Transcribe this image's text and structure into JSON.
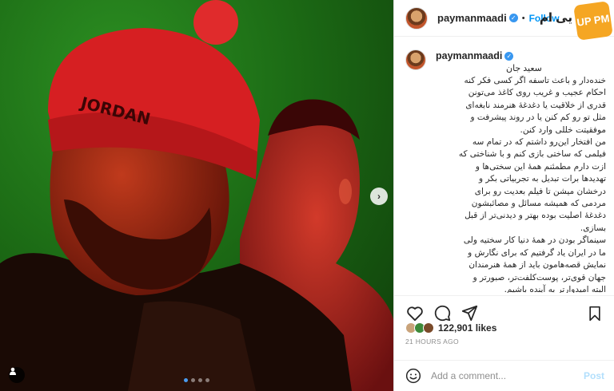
{
  "post": {
    "username": "paymanmaadi",
    "follow_label": "Follow",
    "separator": "•",
    "watermark_text": "یی ام",
    "watermark_logo": "UP PM",
    "caption_user": "paymanmaadi",
    "caption_name": "سعید جان",
    "caption_text": "خنده‌دار و باعث تاسفه اگر کسی فکر کنه\nاحکام عجیب و غریب روی کاغذ می‌تونن\nقدری از خلاقیت یا دغدغهٔ هنرمند نابغه‌ای\nمثل تو رو کم کنن یا در روند پیشرفت و\nموفقیتت خللی وارد کنن.\nمن افتخار این‌رو داشتم که در تمام سه\nفیلمی که ساختی بازی کنم و با شناختی که\nازت دارم مطمئنم همهٔ این سختی‌ها و\nتهدیدها برات تبدیل به تجربیاتی بکر و\nدرخشان میشن تا فیلم بعدیت رو برای\nمردمی که همیشه مسائل و مصائبشون\nدغدغهٔ اصلیت بوده بهتر و دیدنی‌تر از قبل\nبسازی.\nسینماگر بودن در همهٔ دنیا کار سختیه ولی\nما در ایران یاد گرفتیم که برای نگارش و\nنمایش قصه‌هامون باید از همهٔ هنرمندان\nجهان قوی‌تر، پوست‌کلفت‌تر، صبورتر و\nالبته امیدوارتر به آینده باشیم.\nبهترین آثار هنری جهان عمدتا توسط\nآدم‌هایی خلق شدند که ...",
    "likes": "122,901 likes",
    "time": "21 HOURS AGO",
    "comment_placeholder": "Add a comment...",
    "post_label": "Post"
  },
  "icons": {
    "like": "heart-icon",
    "comment": "comment-icon",
    "share": "share-icon",
    "save": "bookmark-icon",
    "emoji": "smile-icon",
    "tag": "user-tag-icon",
    "next": "chevron-right-icon",
    "verified": "verified-badge-icon"
  },
  "carousel": {
    "count": 4,
    "active": 1
  },
  "colors": {
    "follow": "#0095f6",
    "verified": "#3897f0",
    "post_disabled": "#b2dffc",
    "photo_background": "#1c6b15",
    "beanie": "#d61f22"
  },
  "photo": {
    "beanie_text": "JORDAN"
  }
}
